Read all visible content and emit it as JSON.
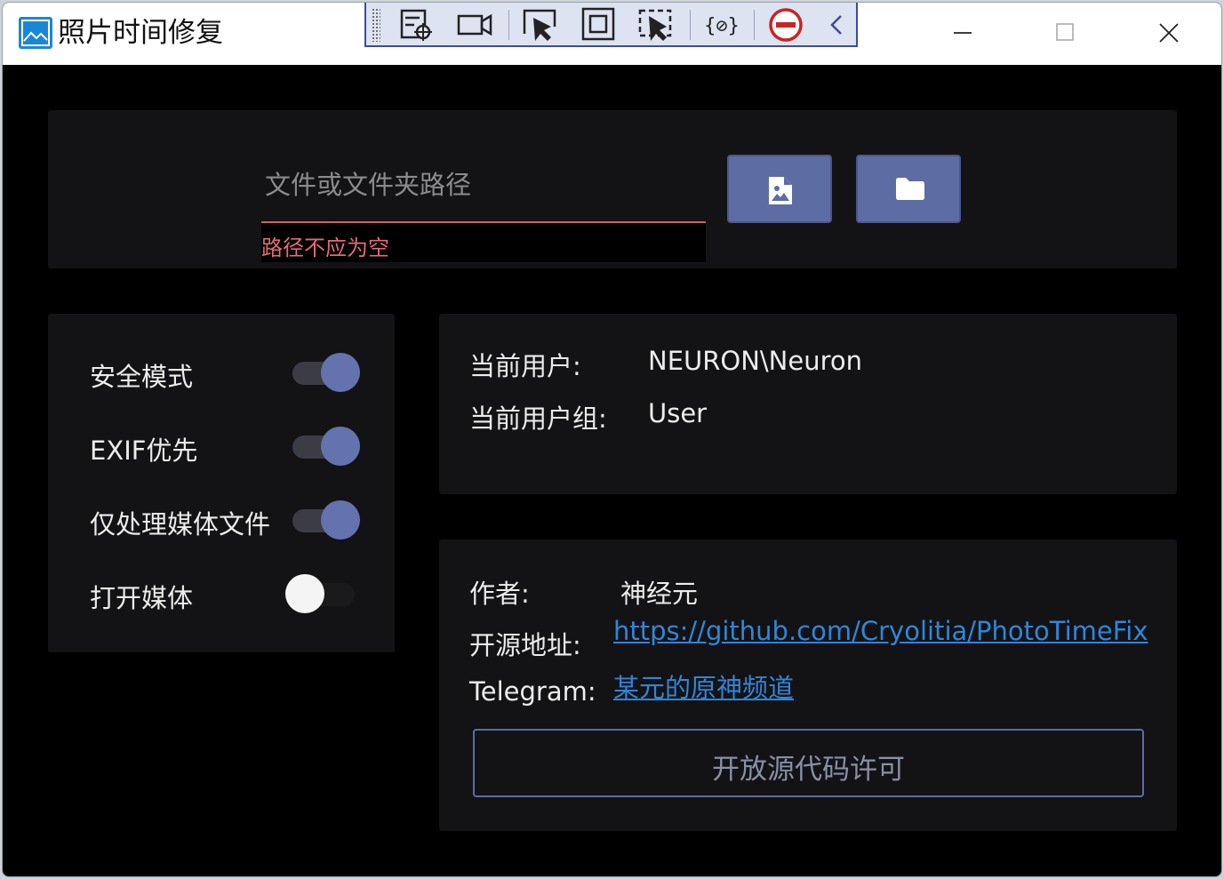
{
  "window": {
    "title": "照片时间修复"
  },
  "debug_toolbar": {
    "icons": [
      "select-element-icon",
      "video-icon",
      "pointer-select-icon",
      "layout-adorner-icon",
      "track-focus-icon",
      "binding-failures-icon",
      "stop-icon",
      "collapse-chevron-icon"
    ]
  },
  "path": {
    "placeholder": "文件或文件夹路径",
    "value": "",
    "error": "路径不应为空"
  },
  "buttons": {
    "select_file_icon": "image-file-icon",
    "select_folder_icon": "folder-icon",
    "license": "开放源代码许可"
  },
  "options": [
    {
      "label": "安全模式",
      "on": true
    },
    {
      "label": "EXIF优先",
      "on": true
    },
    {
      "label": "仅处理媒体文件",
      "on": true
    },
    {
      "label": "打开媒体",
      "on": false
    }
  ],
  "user_info": {
    "user_label": "当前用户:",
    "user_value": "NEURON\\Neuron",
    "group_label": "当前用户组:",
    "group_value": "User"
  },
  "about": {
    "author_label": "作者:",
    "author_value": "神经元",
    "repo_label": "开源地址:",
    "repo_link": "https://github.com/Cryolitia/PhotoTimeFix",
    "telegram_label": "Telegram:",
    "telegram_link": "某元的原神频道"
  },
  "colors": {
    "accent": "#5e6ca4",
    "error": "#e26b78",
    "link": "#2f86d8",
    "panel": "#131315",
    "background": "#000000"
  }
}
